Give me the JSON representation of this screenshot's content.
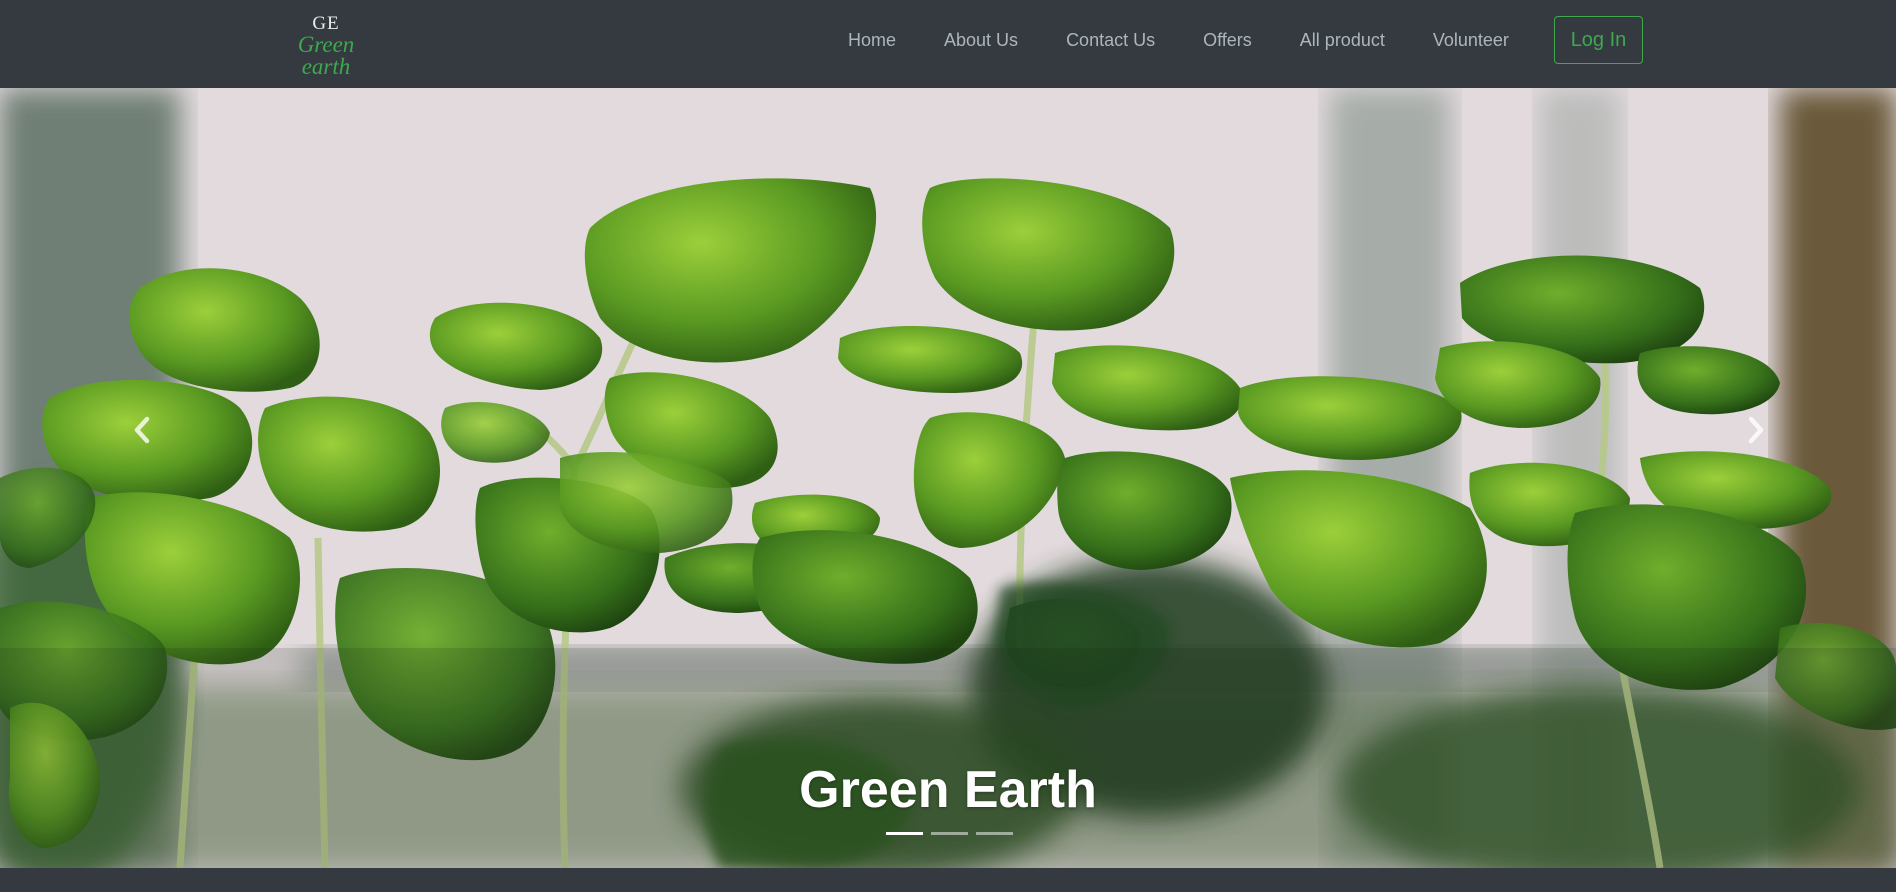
{
  "brand": {
    "monogram": "GE",
    "name": "Green earth"
  },
  "nav": {
    "links": [
      "Home",
      "About Us",
      "Contact Us",
      "Offers",
      "All product",
      "Volunteer"
    ],
    "login_label": "Log In"
  },
  "carousel": {
    "caption": "Green Earth",
    "slide_count": 3,
    "active_slide": 1,
    "prev_icon": "chevron-left-icon",
    "next_icon": "chevron-right-icon"
  },
  "colors": {
    "navbar_bg": "#343a40",
    "accent_green": "#3ea84e",
    "nav_text": "#adb5bd"
  }
}
